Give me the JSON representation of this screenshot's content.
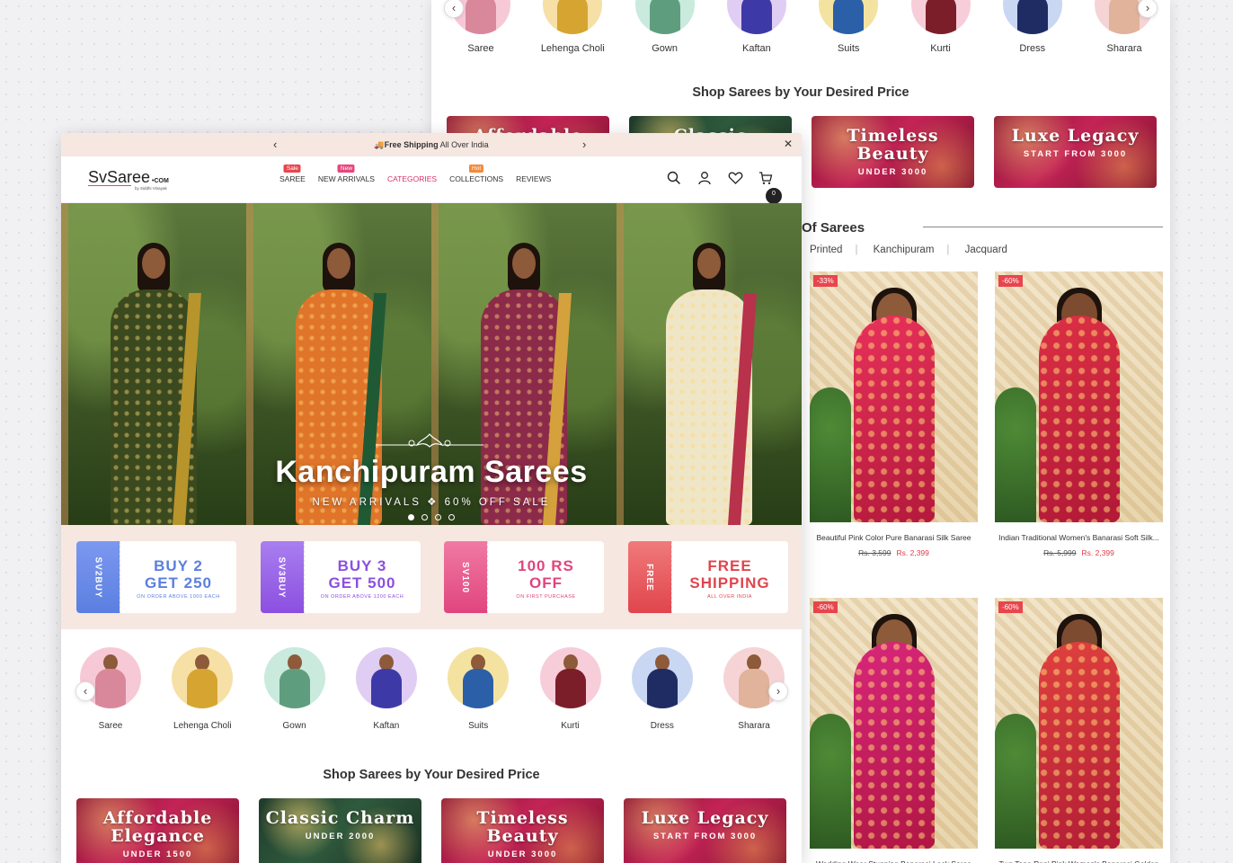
{
  "back_window": {
    "categories": [
      {
        "label": "Saree",
        "bg": "#f7c9d6",
        "dress": "#d9889c"
      },
      {
        "label": "Lehenga Choli",
        "bg": "#f6e0a6",
        "dress": "#d6a531"
      },
      {
        "label": "Gown",
        "bg": "#c9eadc",
        "dress": "#5e9e7e"
      },
      {
        "label": "Kaftan",
        "bg": "#e0cdf3",
        "dress": "#3d3aa8"
      },
      {
        "label": "Suits",
        "bg": "#f4e3a0",
        "dress": "#2b5fa8"
      },
      {
        "label": "Kurti",
        "bg": "#f7cdd9",
        "dress": "#7c1e2a"
      },
      {
        "label": "Dress",
        "bg": "#c9d7f3",
        "dress": "#1f2c64"
      },
      {
        "label": "Sharara",
        "bg": "#f6d4d6",
        "dress": "#e0b39a"
      }
    ],
    "section_title": "Shop Sarees by Your Desired Price",
    "price_cards": [
      {
        "title": "Affordable",
        "sub": "",
        "green": false
      },
      {
        "title": "Classic",
        "sub": "",
        "green": true
      },
      {
        "title": "Timeless Beauty",
        "sub": "UNDER 3000",
        "green": false
      },
      {
        "title": "Luxe Legacy",
        "sub": "START FROM 3000",
        "green": false
      }
    ],
    "fabric_heading": "Of Sarees",
    "fabric_tabs": [
      "Printed",
      "Kanchipuram",
      "Jacquard"
    ],
    "products": [
      {
        "badge": "-33%",
        "name": "Beautiful Pink Color Pure Banarasi Silk Saree",
        "old": "Rs. 3,599",
        "new": "Rs. 2,399",
        "saree": "#e8315a",
        "head": "#8d5a3a"
      },
      {
        "badge": "-60%",
        "name": "Indian Traditional Women's Banarasi Soft Silk...",
        "old": "Rs. 5,999",
        "new": "Rs. 2,399",
        "saree": "#dc2f44",
        "head": "#7d4b30"
      },
      {
        "badge": "-60%",
        "name": "Wedding Wear Stunning Banarasi Lock Saree",
        "old": "",
        "new": "",
        "saree": "#d8267a",
        "head": "#8d5a3a"
      },
      {
        "badge": "-60%",
        "name": "Two Tone Rani Pink Women's Banarasi Golden",
        "old": "",
        "new": "",
        "saree": "#e0413e",
        "head": "#7d4b30"
      }
    ]
  },
  "front_window": {
    "announcement": {
      "bold": "🚚Free Shipping",
      "rest": " All Over India"
    },
    "logo": {
      "name": "SvSaree",
      "com": "COM",
      "by": "by Siddhi Vinayak"
    },
    "menu": [
      {
        "label": "SAREE",
        "tag": "Sale",
        "tag_color": "#e8454d",
        "active": false
      },
      {
        "label": "NEW ARRIVALS",
        "tag": "New",
        "tag_color": "#e8457d",
        "active": false
      },
      {
        "label": "CATEGORIES",
        "tag": "",
        "tag_color": "",
        "active": true
      },
      {
        "label": "COLLECTIONS",
        "tag": "Hot",
        "tag_color": "#f08a3c",
        "active": false
      },
      {
        "label": "REVIEWS",
        "tag": "",
        "tag_color": "",
        "active": false
      }
    ],
    "cart_count": "0",
    "hero": {
      "title": "Kanchipuram Sarees",
      "subtitle": "NEW ARRIVALS ❖ 60% OFF SALE",
      "panels": [
        {
          "saree": "#3b4a1e",
          "border": "#b8942c",
          "head": "#8d5a3a"
        },
        {
          "saree": "#e0752a",
          "border": "#1f5a35",
          "head": "#8d5a3a"
        },
        {
          "saree": "#8c2a4a",
          "border": "#d4a13c",
          "head": "#8d5a3a"
        },
        {
          "saree": "#efe6c8",
          "border": "#b7324a",
          "head": "#8d5a3a"
        }
      ]
    },
    "offers": [
      {
        "code": "SV2BUY",
        "line1": "BUY 2",
        "line2": "GET 250",
        "note": "ON ORDER ABOVE 1000 EACH",
        "color": "#5b7fe0",
        "grad": "#7c98f0"
      },
      {
        "code": "SV3BUY",
        "line1": "BUY 3",
        "line2": "GET 500",
        "note": "ON ORDER ABOVE 1200 EACH",
        "color": "#8b4fe0",
        "grad": "#a97ff0"
      },
      {
        "code": "SV100",
        "line1": "100 RS",
        "line2": "OFF",
        "note": "ON FIRST PURCHASE",
        "color": "#e0457d",
        "grad": "#f07aa3"
      },
      {
        "code": "FREE",
        "line1": "FREE",
        "line2": "SHIPPING",
        "note": "ALL OVER INDIA",
        "color": "#e0454d",
        "grad": "#f07a7a"
      }
    ],
    "categories": [
      {
        "label": "Saree",
        "bg": "#f7c9d6",
        "dress": "#d9889c"
      },
      {
        "label": "Lehenga Choli",
        "bg": "#f6e0a6",
        "dress": "#d6a531"
      },
      {
        "label": "Gown",
        "bg": "#c9eadc",
        "dress": "#5e9e7e"
      },
      {
        "label": "Kaftan",
        "bg": "#e0cdf3",
        "dress": "#3d3aa8"
      },
      {
        "label": "Suits",
        "bg": "#f4e3a0",
        "dress": "#2b5fa8"
      },
      {
        "label": "Kurti",
        "bg": "#f7cdd9",
        "dress": "#7c1e2a"
      },
      {
        "label": "Dress",
        "bg": "#c9d7f3",
        "dress": "#1f2c64"
      },
      {
        "label": "Sharara",
        "bg": "#f6d4d6",
        "dress": "#e0b39a"
      }
    ],
    "section_title": "Shop Sarees by Your Desired Price",
    "price_cards": [
      {
        "title": "Affordable Elegance",
        "sub": "UNDER 1500",
        "green": false
      },
      {
        "title": "Classic Charm",
        "sub": "UNDER 2000",
        "green": true
      },
      {
        "title": "Timeless Beauty",
        "sub": "UNDER 3000",
        "green": false
      },
      {
        "title": "Luxe Legacy",
        "sub": "START FROM 3000",
        "green": false
      }
    ]
  }
}
